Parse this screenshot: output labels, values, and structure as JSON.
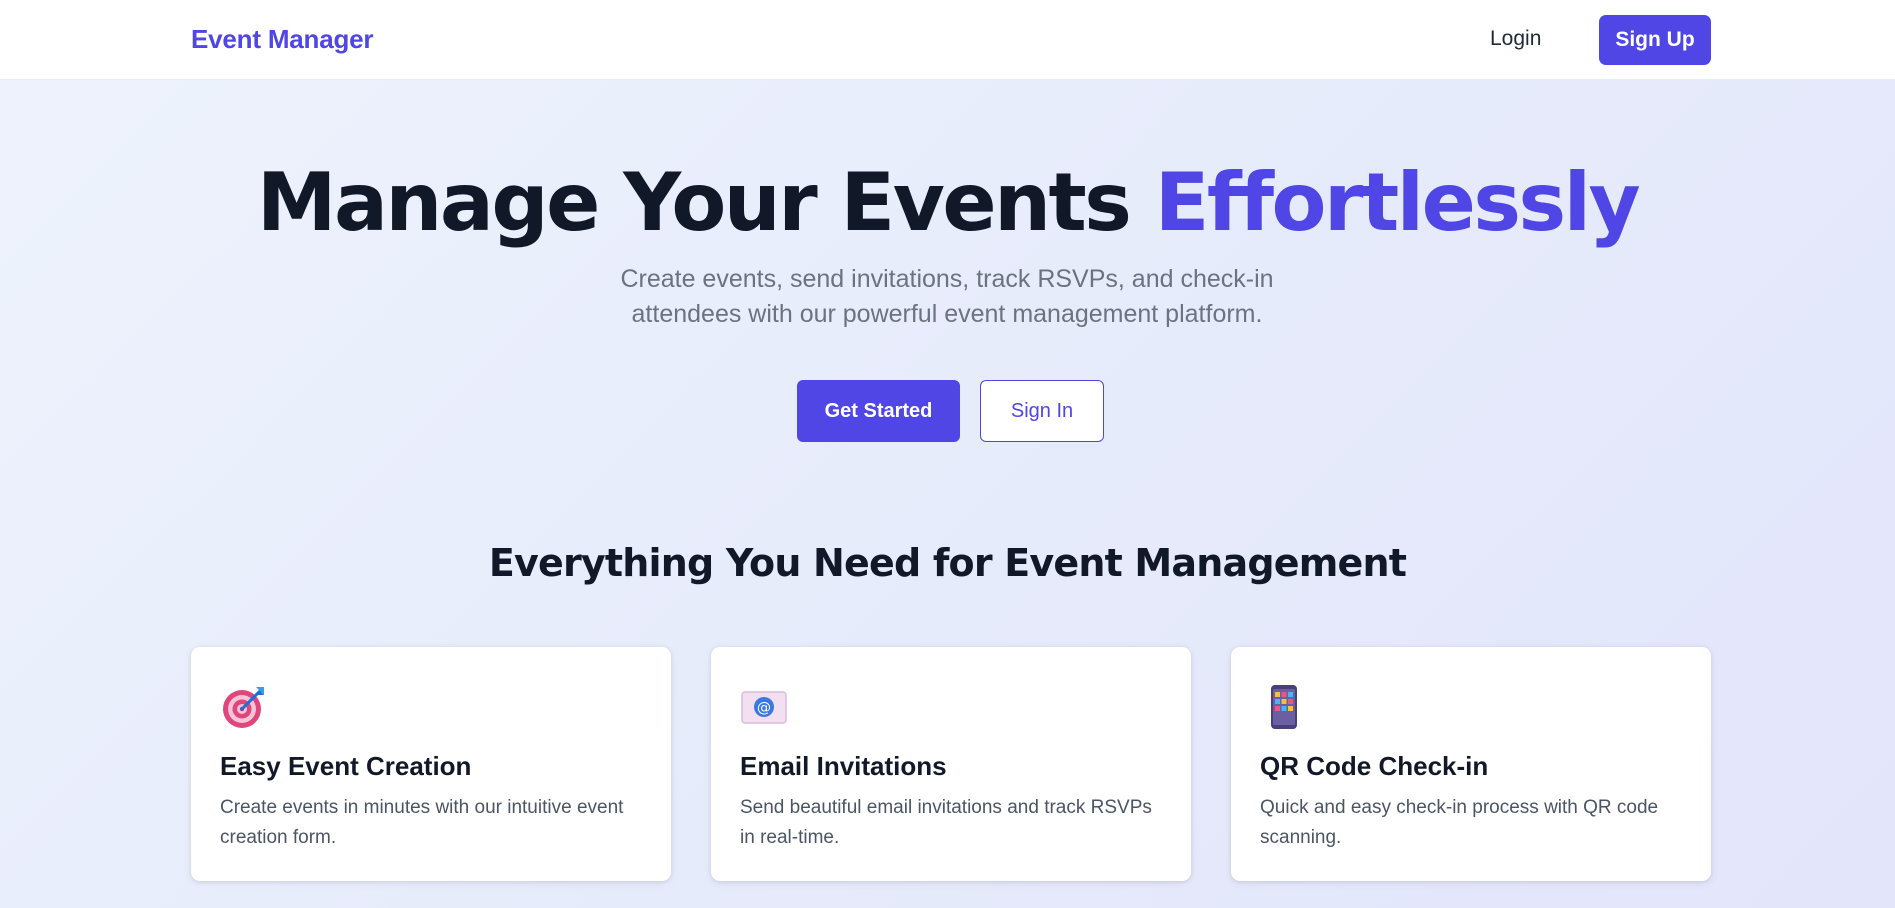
{
  "nav": {
    "brand": "Event Manager",
    "login_label": "Login",
    "signup_label": "Sign Up"
  },
  "hero": {
    "title_main": "Manage Your Events ",
    "title_accent": "Effortlessly",
    "subtitle": "Create events, send invitations, track RSVPs, and check-in attendees with our powerful event management platform.",
    "primary_cta": "Get Started",
    "secondary_cta": "Sign In"
  },
  "features": {
    "heading": "Everything You Need for Event Management",
    "items": [
      {
        "icon": "target-icon",
        "title": "Easy Event Creation",
        "text": "Create events in minutes with our intuitive event creation form."
      },
      {
        "icon": "email-icon",
        "title": "Email Invitations",
        "text": "Send beautiful email invitations and track RSVPs in real-time."
      },
      {
        "icon": "qr-phone-icon",
        "title": "QR Code Check-in",
        "text": "Quick and easy check-in process with QR code scanning."
      }
    ]
  },
  "colors": {
    "accent": "#4f46e5",
    "heading": "#111827",
    "muted": "#6b7280"
  }
}
